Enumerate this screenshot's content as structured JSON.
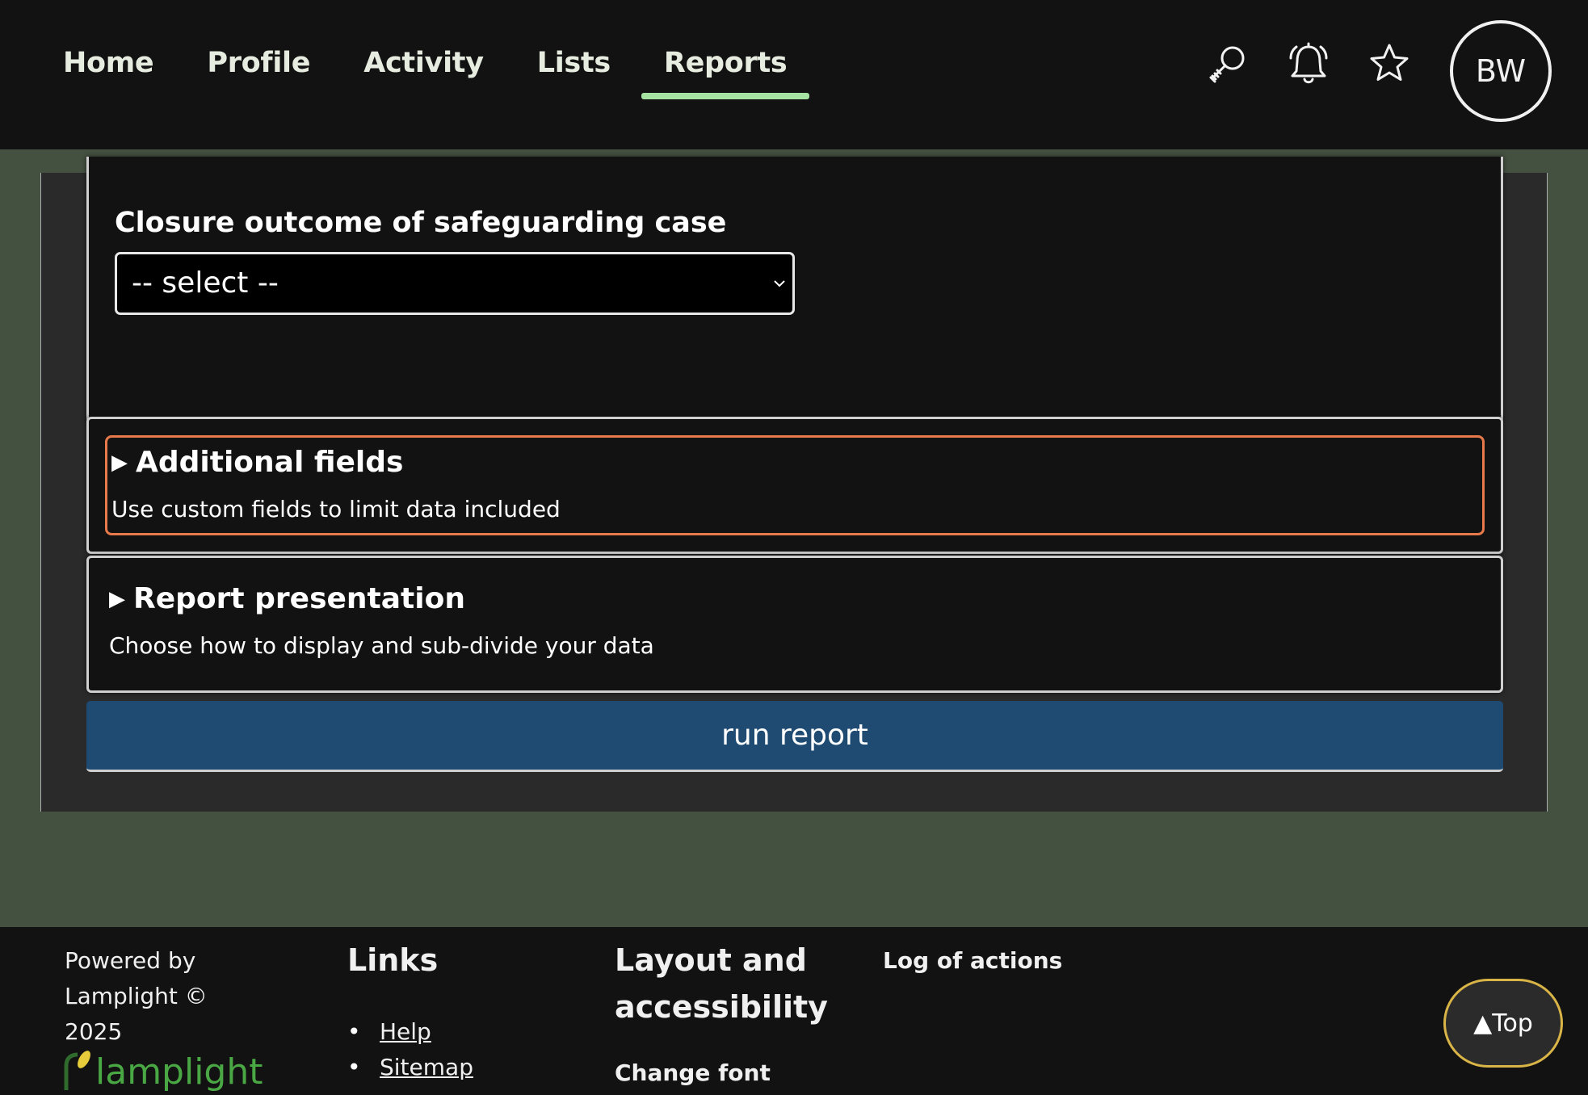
{
  "nav": {
    "items": [
      {
        "label": "Home"
      },
      {
        "label": "Profile"
      },
      {
        "label": "Activity"
      },
      {
        "label": "Lists"
      },
      {
        "label": "Reports",
        "active": true
      }
    ],
    "icons": [
      "search-icon",
      "bell-icon",
      "star-icon"
    ],
    "avatar_initials": "BW"
  },
  "form": {
    "closure_label": "Closure outcome of safeguarding case",
    "closure_select_value": "-- select --",
    "additional_fields": {
      "title": "Additional fields",
      "description": "Use custom fields to limit data included"
    },
    "report_presentation": {
      "title": "Report presentation",
      "description": "Choose how to display and sub-divide your data"
    },
    "run_button": "run report"
  },
  "footer": {
    "powered_line1": "Powered by",
    "powered_line2": "Lamplight ©",
    "powered_line3": "2025",
    "logo_text": "lamplight",
    "links_heading": "Links",
    "links": [
      "Help",
      "Sitemap"
    ],
    "layout_heading_line1": "Layout and",
    "layout_heading_line2": "accessibility",
    "change_font": "Change font",
    "log_of_actions": "Log of actions",
    "top_button": "▲Top"
  },
  "colors": {
    "nav_bg": "#121212",
    "page_bg": "#445040",
    "active_underline": "#a6e3a1",
    "focus_outline": "#e8794a",
    "run_button_bg": "#1f4b72",
    "top_button_border": "#d9b447",
    "logo_green": "#4aa844"
  }
}
